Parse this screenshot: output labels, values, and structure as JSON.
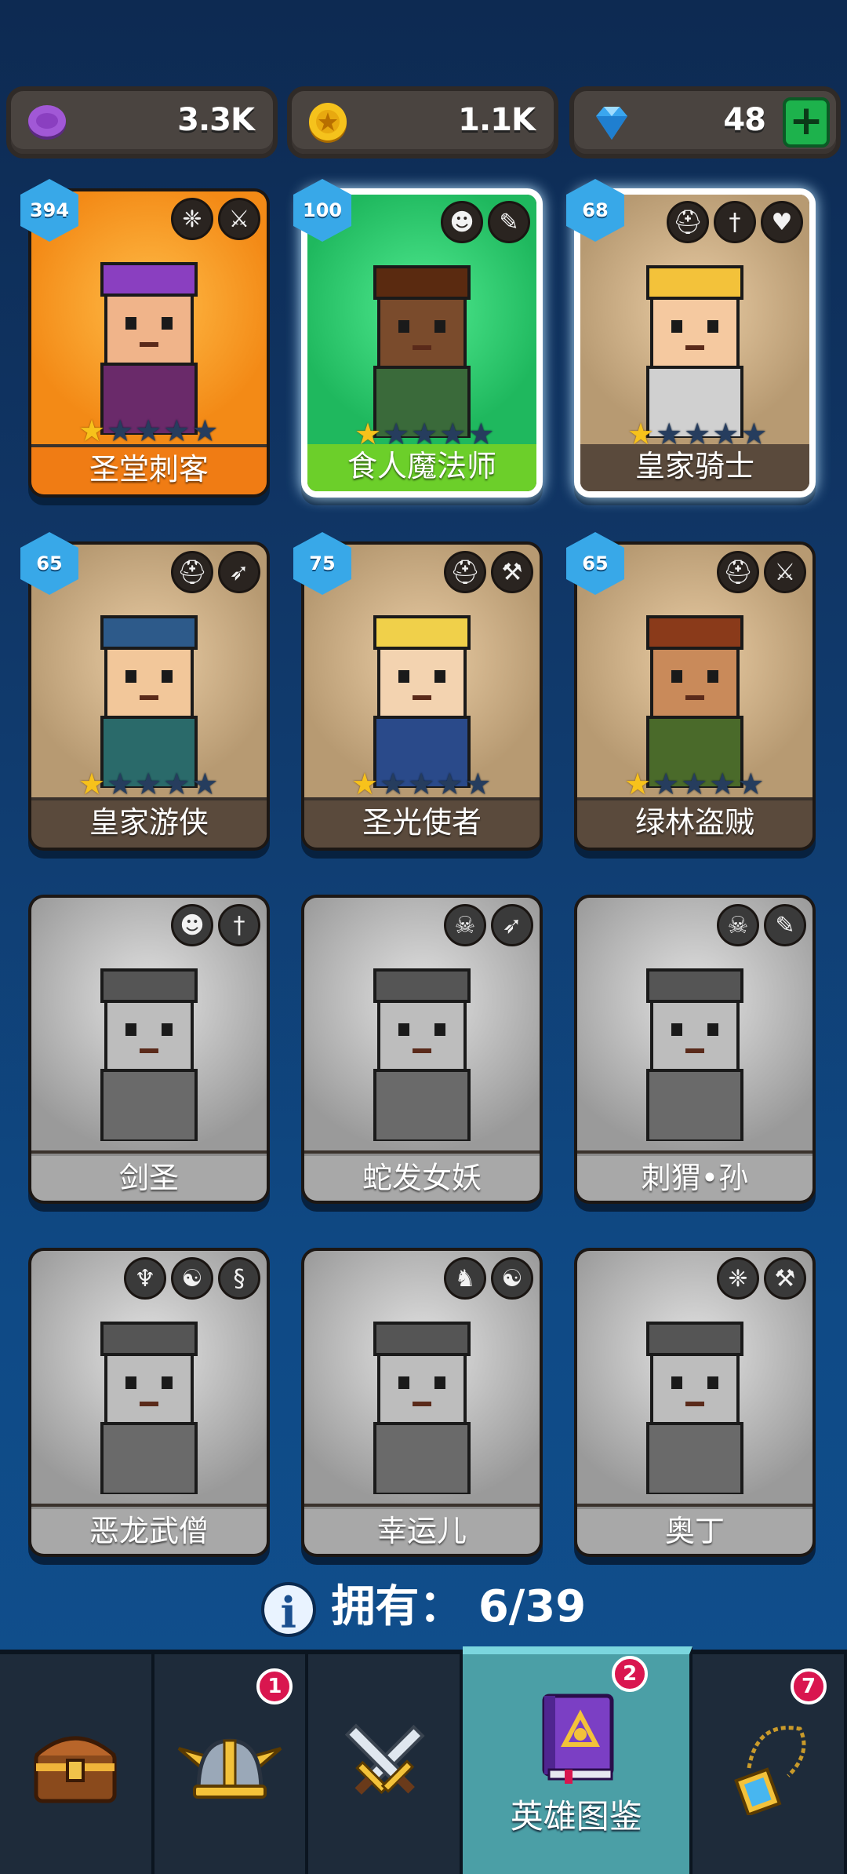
{
  "resources": {
    "purple_coin": {
      "value": "3.3K",
      "icon": "purple-coin-icon"
    },
    "gold_coin": {
      "value": "1.1K",
      "icon": "gold-coin-icon"
    },
    "gems": {
      "value": "48",
      "icon": "diamond-icon",
      "add_label": "+"
    }
  },
  "heroes": [
    {
      "name": "圣堂刺客",
      "level": "394",
      "stars": 1,
      "owned": true,
      "bg": "#f38a16",
      "namebar": "#f07c14",
      "tags": [
        "wings-icon",
        "dagger-icon"
      ]
    },
    {
      "name": "食人魔法师",
      "level": "100",
      "stars": 1,
      "owned": true,
      "bg": "#1fb85e",
      "namebar": "#6ccf2a",
      "selected": true,
      "tags": [
        "ogre-icon",
        "wand-icon"
      ]
    },
    {
      "name": "皇家骑士",
      "level": "68",
      "stars": 1,
      "owned": true,
      "bg": "#b79a72",
      "namebar": "#5a4a3c",
      "selected": true,
      "tags": [
        "helmet-icon",
        "sword-icon",
        "heart-icon"
      ]
    },
    {
      "name": "皇家游侠",
      "level": "65",
      "stars": 1,
      "owned": true,
      "bg": "#b79a72",
      "namebar": "#5a4a3c",
      "tags": [
        "helmet-icon",
        "bow-icon"
      ]
    },
    {
      "name": "圣光使者",
      "level": "75",
      "stars": 1,
      "owned": true,
      "bg": "#b79a72",
      "namebar": "#5a4a3c",
      "tags": [
        "helmet-icon",
        "hammer-icon"
      ]
    },
    {
      "name": "绿林盗贼",
      "level": "65",
      "stars": 1,
      "owned": true,
      "bg": "#b79a72",
      "namebar": "#5a4a3c",
      "tags": [
        "helmet-icon",
        "dagger-icon"
      ]
    },
    {
      "name": "剑圣",
      "owned": false,
      "tags": [
        "ogre-icon",
        "sword-icon"
      ]
    },
    {
      "name": "蛇发女妖",
      "owned": false,
      "tags": [
        "skull-icon",
        "bow-icon"
      ]
    },
    {
      "name": "刺猬•孙",
      "owned": false,
      "tags": [
        "skull-icon",
        "wand-icon"
      ]
    },
    {
      "name": "恶龙武僧",
      "owned": false,
      "tags": [
        "demon-icon",
        "beast-icon",
        "dragon-icon"
      ]
    },
    {
      "name": "幸运儿",
      "owned": false,
      "tags": [
        "elf-icon",
        "beast-icon"
      ]
    },
    {
      "name": "奥丁",
      "owned": false,
      "tags": [
        "wings-icon",
        "hammer-icon"
      ]
    }
  ],
  "summary": {
    "label": "拥有：",
    "count": "6/39"
  },
  "nav": {
    "tabs": [
      {
        "id": "chest",
        "icon": "treasure-chest-icon",
        "badge": null
      },
      {
        "id": "helmet",
        "icon": "viking-helmet-icon",
        "badge": "1"
      },
      {
        "id": "battle",
        "icon": "crossed-swords-icon",
        "badge": null
      },
      {
        "id": "encyclopedia",
        "icon": "hero-book-icon",
        "badge": "2",
        "label": "英雄图鉴",
        "active": true
      },
      {
        "id": "amulet",
        "icon": "amulet-icon",
        "badge": "7"
      }
    ]
  }
}
